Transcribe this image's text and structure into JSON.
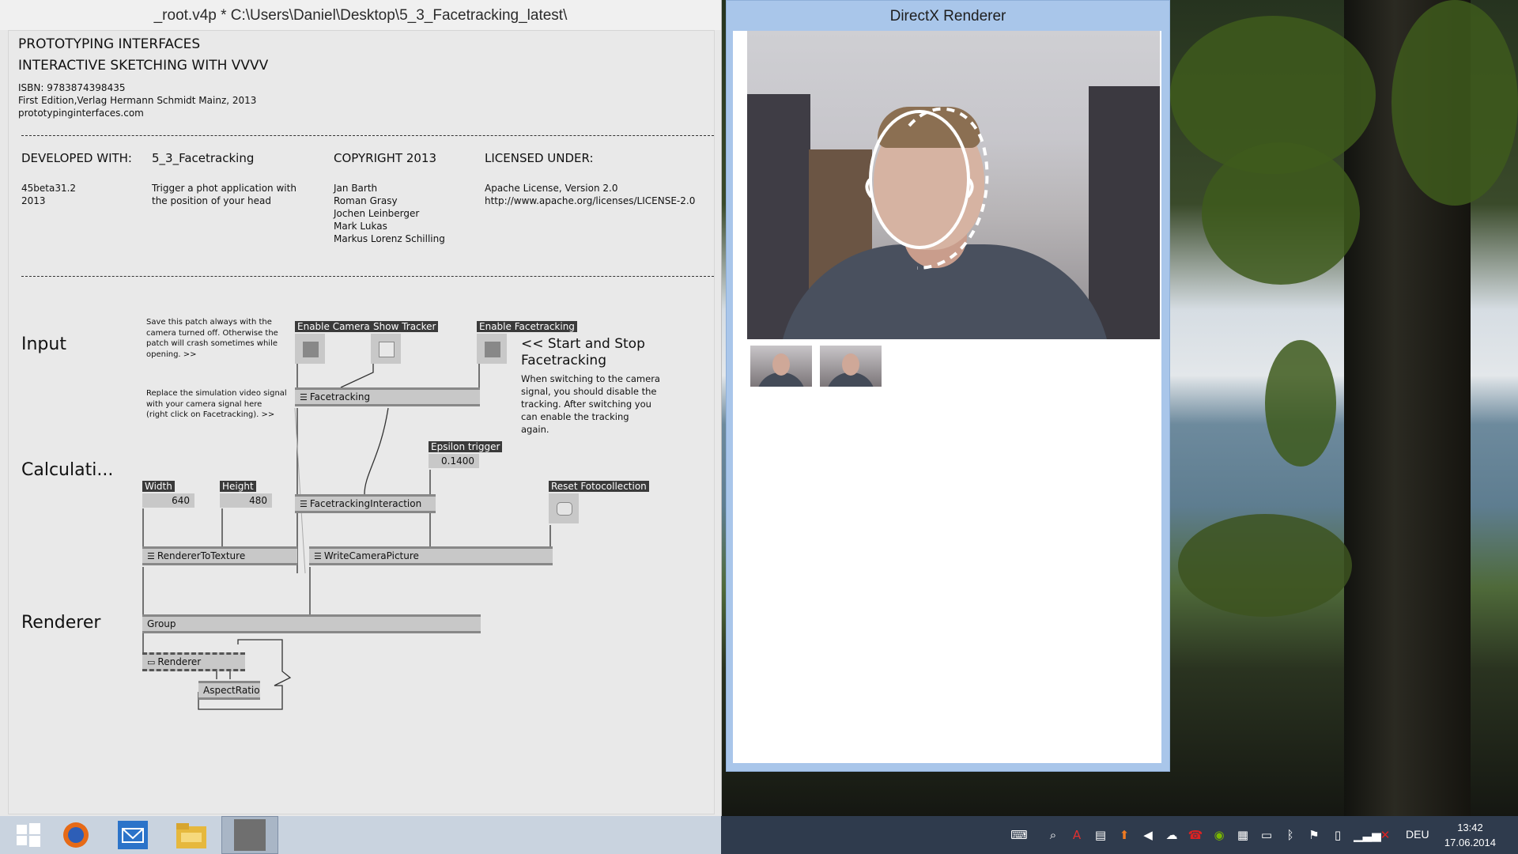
{
  "vvvv": {
    "title": "_root.v4p *  C:\\Users\\Daniel\\Desktop\\5_3_Facetracking_latest\\",
    "header": {
      "line1": "PROTOTYPING INTERFACES",
      "line2": "INTERACTIVE SKETCHING WITH VVVV",
      "isbn": "ISBN: 9783874398435",
      "edition": "First Edition,Verlag Hermann Schmidt Mainz, 2013",
      "url": "prototypinginterfaces.com"
    },
    "info": {
      "developed_title": "DEVELOPED WITH:",
      "developed_lines": [
        "45beta31.2",
        "2013"
      ],
      "project_title": "5_3_Facetracking",
      "project_lines": [
        "Trigger a phot application with",
        "the position of your head"
      ],
      "copyright_title": "COPYRIGHT 2013",
      "authors": [
        "Jan Barth",
        "Roman Grasy",
        "Jochen Leinberger",
        "Mark Lukas",
        "Markus Lorenz Schilling"
      ],
      "license_title": "LICENSED UNDER:",
      "license_lines": [
        "Apache License, Version 2.0",
        "http://www.apache.org/licenses/LICENSE-2.0"
      ]
    },
    "sections": {
      "input": "Input",
      "calc": "Calculati...",
      "renderer": "Renderer"
    },
    "notes": {
      "save": [
        "Save this patch always with the",
        "camera turned off. Otherwise the",
        "patch will crash sometimes while",
        "opening. >>"
      ],
      "replace": [
        "Replace the simulation video signal",
        "with your camera signal here",
        "(right click on Facetracking). >>"
      ],
      "start_title": [
        "<< Start and Stop",
        "Facetracking"
      ],
      "start_body": [
        "When switching to the camera",
        "signal, you should disable the",
        "tracking. After switching you",
        "can enable the tracking",
        "again."
      ]
    },
    "ionodes": {
      "enable_camera": "Enable Camera",
      "show_tracker": "Show Tracker",
      "enable_facetracking": "Enable Facetracking",
      "epsilon": "Epsilon trigger",
      "width": "Width",
      "height": "Height",
      "reset": "Reset Fotocollection"
    },
    "values": {
      "epsilon": "0.1400",
      "width": "640",
      "height": "480"
    },
    "toggles": {
      "enable_camera": true,
      "show_tracker": false,
      "enable_facetracking": true
    },
    "nodes": {
      "facetracking": "Facetracking",
      "interaction": "FacetrackingInteraction",
      "renderer_to_texture": "RendererToTexture",
      "write_camera": "WriteCameraPicture",
      "group": "Group",
      "renderer": "Renderer",
      "aspect": "AspectRatio"
    }
  },
  "directx": {
    "title": "DirectX Renderer"
  },
  "taskbar": {
    "apps": [
      "windows-start",
      "firefox",
      "mail",
      "file-explorer",
      "vvvv"
    ],
    "language": "DEU",
    "time": "13:42",
    "date": "17.06.2014"
  }
}
